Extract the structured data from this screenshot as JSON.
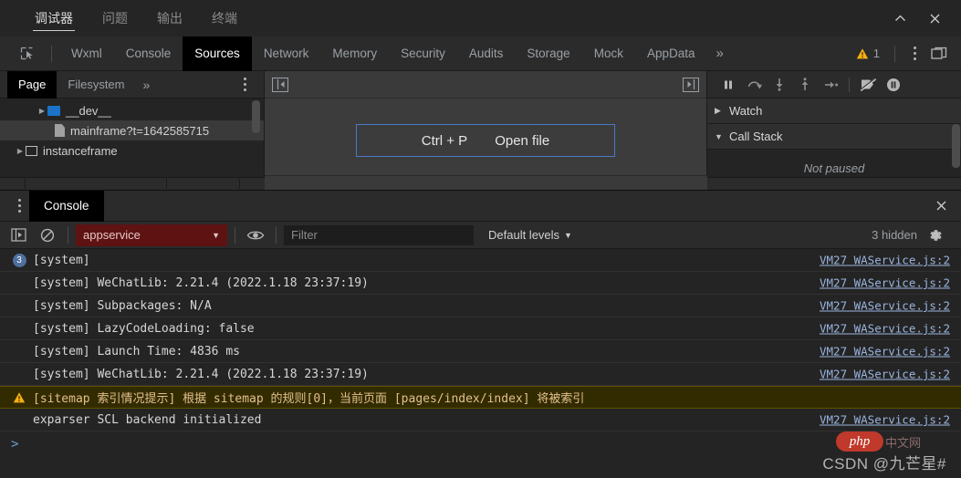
{
  "window": {
    "ide_tabs": [
      {
        "label": "调试器",
        "active": true
      },
      {
        "label": "问题",
        "active": false
      },
      {
        "label": "输出",
        "active": false
      },
      {
        "label": "终端",
        "active": false
      }
    ],
    "collapse_icon": "chevron-up-icon",
    "close_icon": "close-icon"
  },
  "devtools": {
    "inspect_icon": "inspect-element-icon",
    "tabs": [
      {
        "label": "Wxml",
        "active": false
      },
      {
        "label": "Console",
        "active": false
      },
      {
        "label": "Sources",
        "active": true
      },
      {
        "label": "Network",
        "active": false
      },
      {
        "label": "Memory",
        "active": false
      },
      {
        "label": "Security",
        "active": false
      },
      {
        "label": "Audits",
        "active": false
      },
      {
        "label": "Storage",
        "active": false
      },
      {
        "label": "Mock",
        "active": false
      },
      {
        "label": "AppData",
        "active": false
      }
    ],
    "overflow_label": "»",
    "warning_icon": "warning-triangle-icon",
    "warning_count": "1",
    "kebab_icon": "more-options-icon",
    "dock_icon": "dock-window-icon"
  },
  "sources": {
    "navigator": {
      "tabs": [
        {
          "label": "Page",
          "active": true
        },
        {
          "label": "Filesystem",
          "active": false
        }
      ],
      "overflow_label": "»",
      "kebab_icon": "navigator-more-options-icon",
      "tree": [
        {
          "label": "__dev__",
          "icon": "folder-icon",
          "indent": 2,
          "twisty": "▶",
          "selected": false
        },
        {
          "label": "mainframe?t=1642585715",
          "icon": "file-icon",
          "indent": 3,
          "twisty": "",
          "selected": true
        },
        {
          "label": "instanceframe",
          "icon": "frame-icon",
          "indent": 1,
          "twisty": "▶",
          "selected": false
        }
      ]
    },
    "editor": {
      "left_toggle_icon": "show-navigator-icon",
      "right_toggle_icon": "show-debugger-icon",
      "hint_shortcut": "Ctrl + P",
      "hint_action": "Open file"
    },
    "debugger": {
      "buttons": [
        {
          "name": "pause-script-button",
          "icon": "pause-icon"
        },
        {
          "name": "step-over-button",
          "icon": "step-over-icon"
        },
        {
          "name": "step-into-button",
          "icon": "step-into-icon"
        },
        {
          "name": "step-out-button",
          "icon": "step-out-icon"
        },
        {
          "name": "step-button",
          "icon": "step-icon"
        },
        {
          "name": "deactivate-breakpoints-button",
          "icon": "deactivate-breakpoints-icon"
        },
        {
          "name": "pause-on-exceptions-button",
          "icon": "pause-on-exceptions-icon"
        }
      ],
      "sections": [
        {
          "label": "Watch",
          "expanded": false,
          "caret": "▶"
        },
        {
          "label": "Call Stack",
          "expanded": true,
          "caret": "▼"
        }
      ],
      "callstack_empty": "Not paused"
    }
  },
  "console": {
    "drawer_tabs": [
      {
        "label": "Console",
        "active": true
      }
    ],
    "drawer_kebab_icon": "drawer-more-options-icon",
    "drawer_close_icon": "drawer-close-icon",
    "toolbar": {
      "sidebar_icon": "console-sidebar-icon",
      "clear_icon": "clear-console-icon",
      "context": "appservice",
      "context_arrow": "▼",
      "eye_icon": "live-expression-icon",
      "filter_placeholder": "Filter",
      "filter_value": "",
      "levels_label": "Default levels",
      "levels_arrow": "▼",
      "hidden_label": "3 hidden",
      "settings_icon": "console-settings-icon"
    },
    "messages": [
      {
        "badge": "3",
        "level": "info",
        "text": "[system]",
        "source": "VM27 WAService.js:2"
      },
      {
        "badge": "",
        "level": "info",
        "text": "[system] WeChatLib: 2.21.4 (2022.1.18 23:37:19)",
        "source": "VM27 WAService.js:2"
      },
      {
        "badge": "",
        "level": "info",
        "text": "[system] Subpackages: N/A",
        "source": "VM27 WAService.js:2"
      },
      {
        "badge": "",
        "level": "info",
        "text": "[system] LazyCodeLoading: false",
        "source": "VM27 WAService.js:2"
      },
      {
        "badge": "",
        "level": "info",
        "text": "[system] Launch Time: 4836 ms",
        "source": "VM27 WAService.js:2"
      },
      {
        "badge": "",
        "level": "info",
        "text": "[system] WeChatLib: 2.21.4 (2022.1.18 23:37:19)",
        "source": "VM27 WAService.js:2"
      },
      {
        "badge": "",
        "level": "warning",
        "text": "[sitemap 索引情况提示] 根据 sitemap 的规则[0]，当前页面 [pages/index/index] 将被索引",
        "source": ""
      },
      {
        "badge": "",
        "level": "info",
        "text": "exparser SCL backend initialized",
        "source": "VM27 WAService.js:2"
      }
    ],
    "prompt_symbol": ">"
  },
  "watermark": {
    "text": "CSDN @九芒星#",
    "logo_primary": "php",
    "logo_secondary": "中文网"
  },
  "colors": {
    "accent_blue": "#4a79c8",
    "warning_yellow": "#e2c08d",
    "context_red": "#5e1212",
    "link_blue": "#9ab4de",
    "folder_blue": "#1a73c8"
  }
}
